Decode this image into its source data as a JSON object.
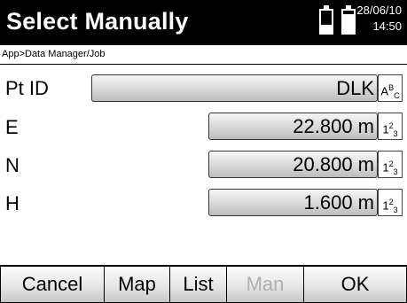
{
  "header": {
    "title": "Select Manually",
    "date": "28/06/10",
    "time": "14:50",
    "battery_levels": [
      0.35,
      0.85
    ]
  },
  "breadcrumb": "App>Data Manager/Job",
  "fields": [
    {
      "label": "Pt ID",
      "value": "DLK",
      "mode": {
        "base": "A",
        "sup": "B",
        "sub": "C"
      }
    },
    {
      "label": "E",
      "value": "22.800 m",
      "mode": {
        "base": "1",
        "sup": "2",
        "sub": "3"
      }
    },
    {
      "label": "N",
      "value": "20.800 m",
      "mode": {
        "base": "1",
        "sup": "2",
        "sub": "3"
      }
    },
    {
      "label": "H",
      "value": "1.600 m",
      "mode": {
        "base": "1",
        "sup": "2",
        "sub": "3"
      }
    }
  ],
  "buttons": [
    {
      "label": "Cancel",
      "enabled": true
    },
    {
      "label": "Map",
      "enabled": true
    },
    {
      "label": "List",
      "enabled": true
    },
    {
      "label": "Man",
      "enabled": false
    },
    {
      "label": "OK",
      "enabled": true
    }
  ]
}
